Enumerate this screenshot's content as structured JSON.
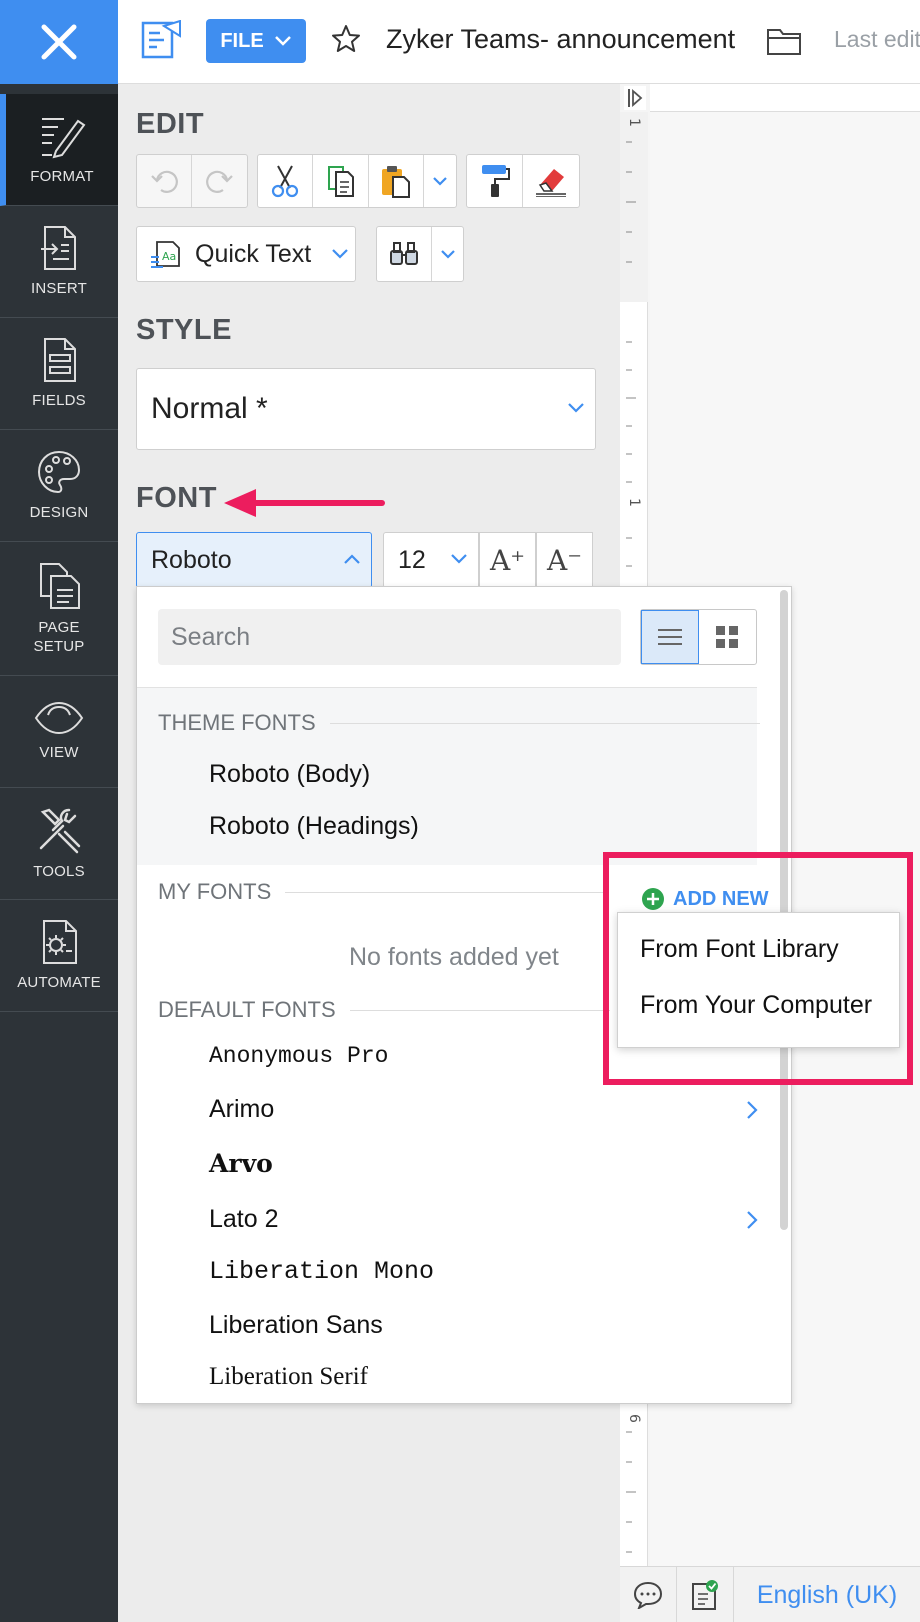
{
  "rail": {
    "items": [
      {
        "label": "FORMAT"
      },
      {
        "label": "INSERT"
      },
      {
        "label": "FIELDS"
      },
      {
        "label": "DESIGN"
      },
      {
        "label": "PAGE SETUP"
      },
      {
        "label": "VIEW"
      },
      {
        "label": "TOOLS"
      },
      {
        "label": "AUTOMATE"
      }
    ]
  },
  "topbar": {
    "file_label": "FILE",
    "doc_title": "Zyker Teams- announcement",
    "last_edit": "Last edit"
  },
  "panel": {
    "edit_heading": "EDIT",
    "quick_text_label": "Quick Text",
    "style_heading": "STYLE",
    "style_value": "Normal *",
    "font_heading": "FONT",
    "font_value": "Roboto",
    "size_value": "12",
    "grow_label": "A⁺",
    "shrink_label": "A⁻"
  },
  "dropdown": {
    "search_placeholder": "Search",
    "theme_heading": "THEME FONTS",
    "theme_fonts": [
      "Roboto (Body)",
      "Roboto (Headings)"
    ],
    "my_fonts_heading": "MY FONTS",
    "add_new_label": "ADD NEW",
    "no_fonts_text": "No fonts added yet",
    "default_heading": "DEFAULT FONTS",
    "default_fonts": [
      "Anonymous Pro",
      "Arimo",
      "Arvo",
      "Lato 2",
      "Liberation Mono",
      "Liberation Sans",
      "Liberation Serif"
    ]
  },
  "add_new_menu": {
    "items": [
      "From Font Library",
      "From Your Computer"
    ]
  },
  "ruler": {
    "marks": [
      "1",
      "1",
      "6"
    ]
  },
  "statusbar": {
    "language": "English (UK)"
  },
  "colors": {
    "accent": "#3f8ef0",
    "rail_bg": "#2d3338",
    "highlight": "#ec1d5e"
  }
}
